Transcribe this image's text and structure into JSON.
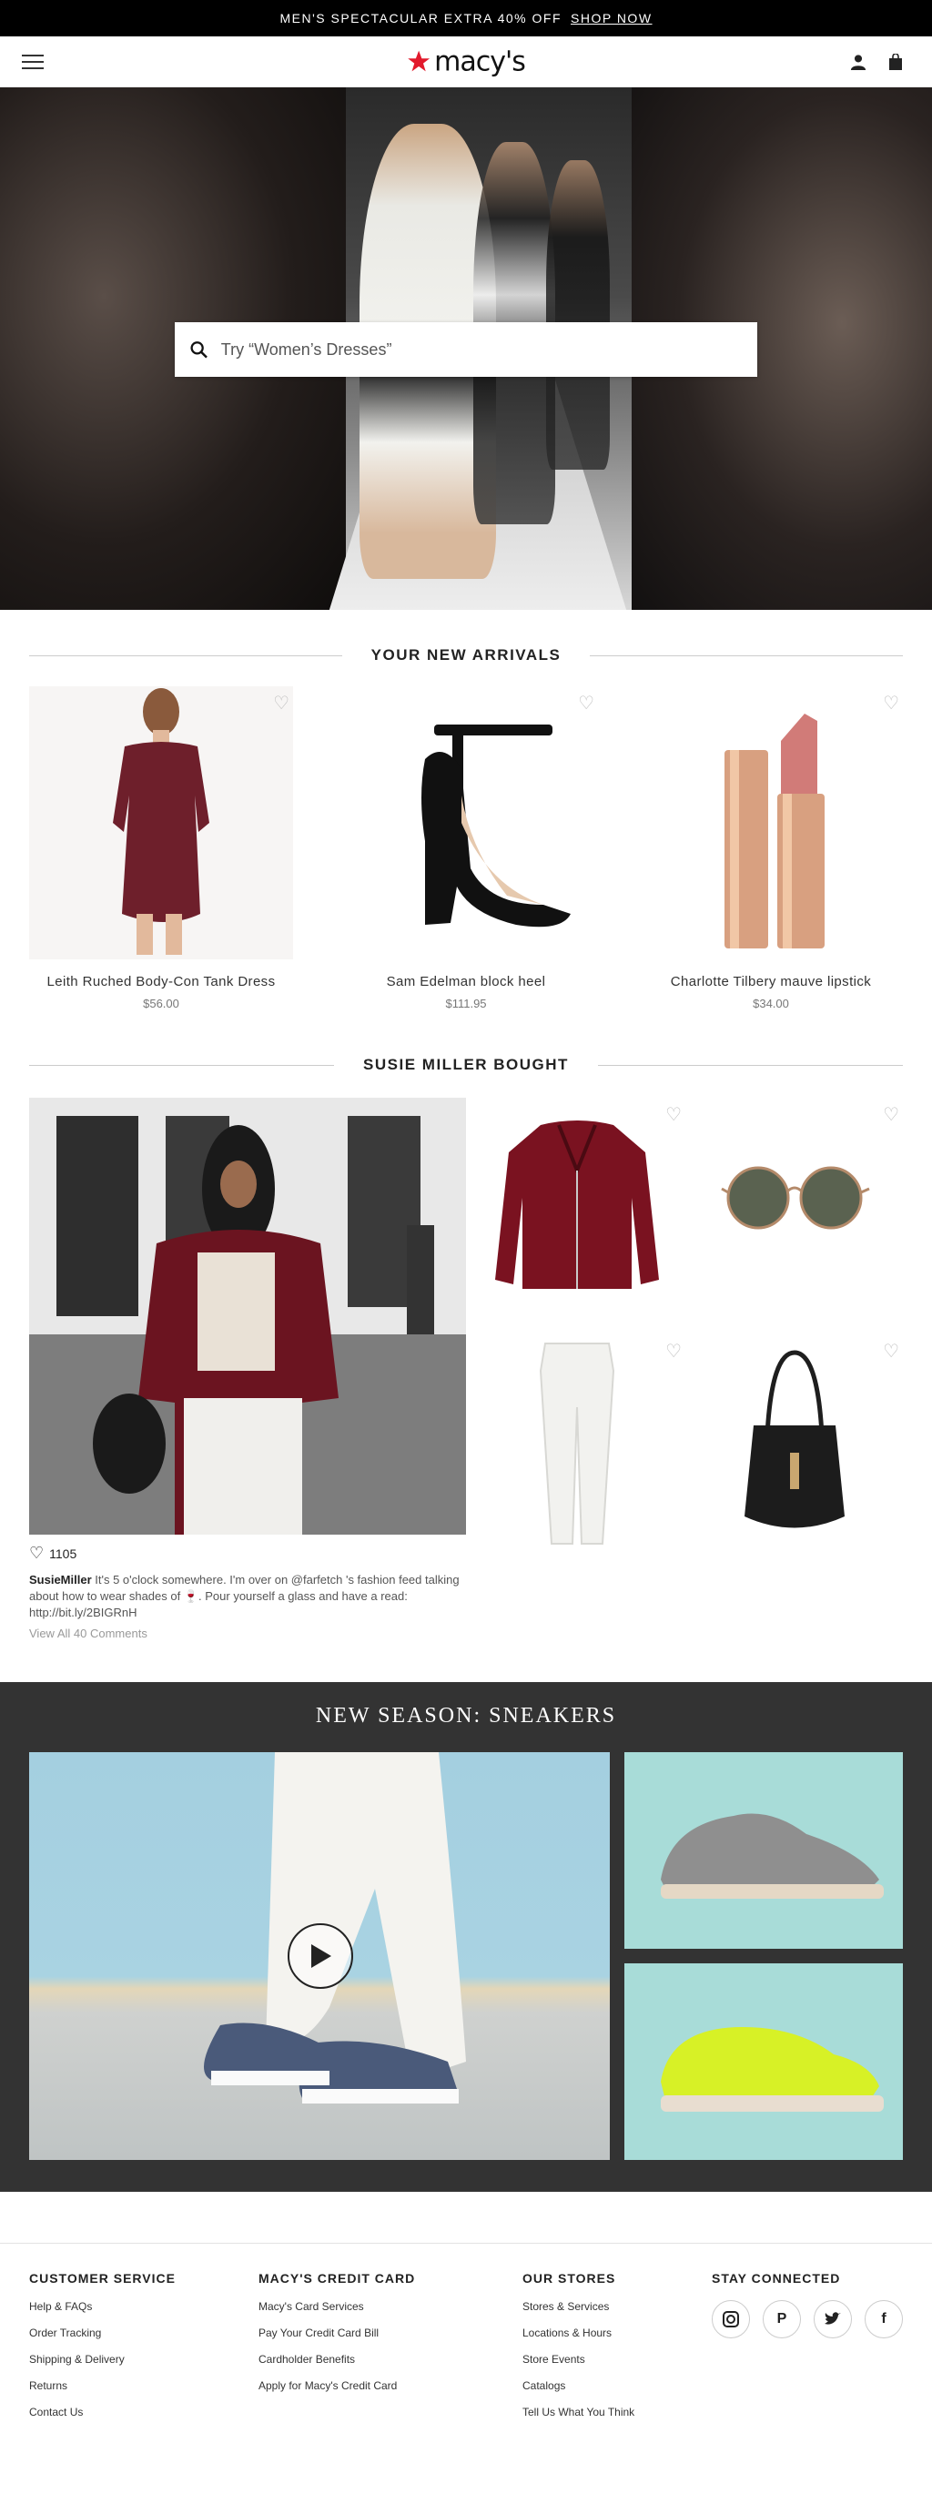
{
  "promo": {
    "text": "MEN'S SPECTACULAR EXTRA 40% OFF",
    "link": "SHOP NOW"
  },
  "header": {
    "logo_text": "macy's",
    "icons": [
      "menu-icon",
      "star-icon",
      "account-icon",
      "bag-icon"
    ]
  },
  "hero": {
    "search_placeholder": "Try “Women’s Dresses”"
  },
  "new_arrivals": {
    "title": "YOUR NEW ARRIVALS",
    "products": [
      {
        "name": "Leith Ruched Body-Con Tank Dress",
        "price": "$56.00"
      },
      {
        "name": "Sam Edelman block heel",
        "price": "$111.95"
      },
      {
        "name": "Charlotte Tilbery mauve lipstick",
        "price": "$34.00"
      }
    ]
  },
  "susie": {
    "title": "SUSIE MILLER BOUGHT",
    "likes": "1105",
    "user": "SusieMiller",
    "caption_before": "It's 5 o'clock somewhere. I'm over on @farfetch 's fashion feed talking about how to wear shades of ",
    "caption_after": ". Pour yourself a glass and have a read: http://bit.ly/2BIGRnH",
    "comments": "View All 40 Comments"
  },
  "sneakers": {
    "title": "NEW SEASON: SNEAKERS"
  },
  "footer": {
    "cols": [
      {
        "title": "CUSTOMER SERVICE",
        "links": [
          "Help & FAQs",
          "Order Tracking",
          "Shipping & Delivery",
          "Returns",
          "Contact Us"
        ]
      },
      {
        "title": "MACY'S CREDIT CARD",
        "links": [
          "Macy's Card Services",
          "Pay Your Credit Card Bill",
          "Cardholder Benefits",
          "Apply for Macy's Credit Card"
        ]
      },
      {
        "title": "OUR STORES",
        "links": [
          "Stores & Services",
          "Locations & Hours",
          "Store Events",
          "Catalogs",
          "Tell Us What You Think"
        ]
      },
      {
        "title": "STAY CONNECTED",
        "links": []
      }
    ],
    "social": [
      "instagram-icon",
      "pinterest-icon",
      "twitter-icon",
      "facebook-icon"
    ]
  },
  "colors": {
    "brand_red": "#e21a2c",
    "dark_band": "#333333"
  }
}
